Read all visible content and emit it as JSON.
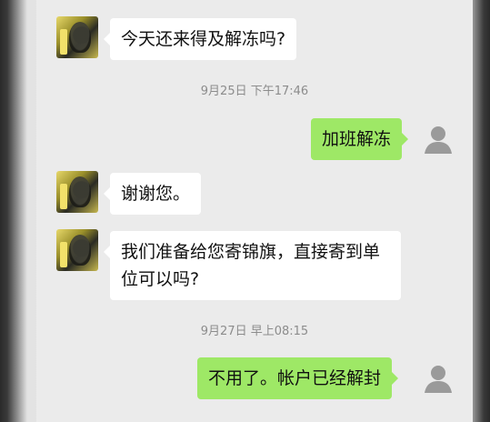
{
  "messages": [
    {
      "side": "in",
      "text": "今天还来得及解冻吗?"
    },
    {
      "timestamp": "9月25日 下午17:46"
    },
    {
      "side": "out",
      "text": "加班解冻"
    },
    {
      "side": "in",
      "text": "谢谢您。"
    },
    {
      "side": "in",
      "text": "我们准备给您寄锦旗，直接寄到单位可以吗?"
    },
    {
      "timestamp": "9月27日 早上08:15"
    },
    {
      "side": "out",
      "text": "不用了。帐户已经解封"
    }
  ],
  "icons": {
    "contact_avatar": "contact-avatar-image",
    "self_avatar": "default-person-icon"
  },
  "colors": {
    "background": "#ebebeb",
    "incoming_bubble": "#ffffff",
    "outgoing_bubble": "#9ee866",
    "timestamp_text": "#8c8c8c"
  }
}
